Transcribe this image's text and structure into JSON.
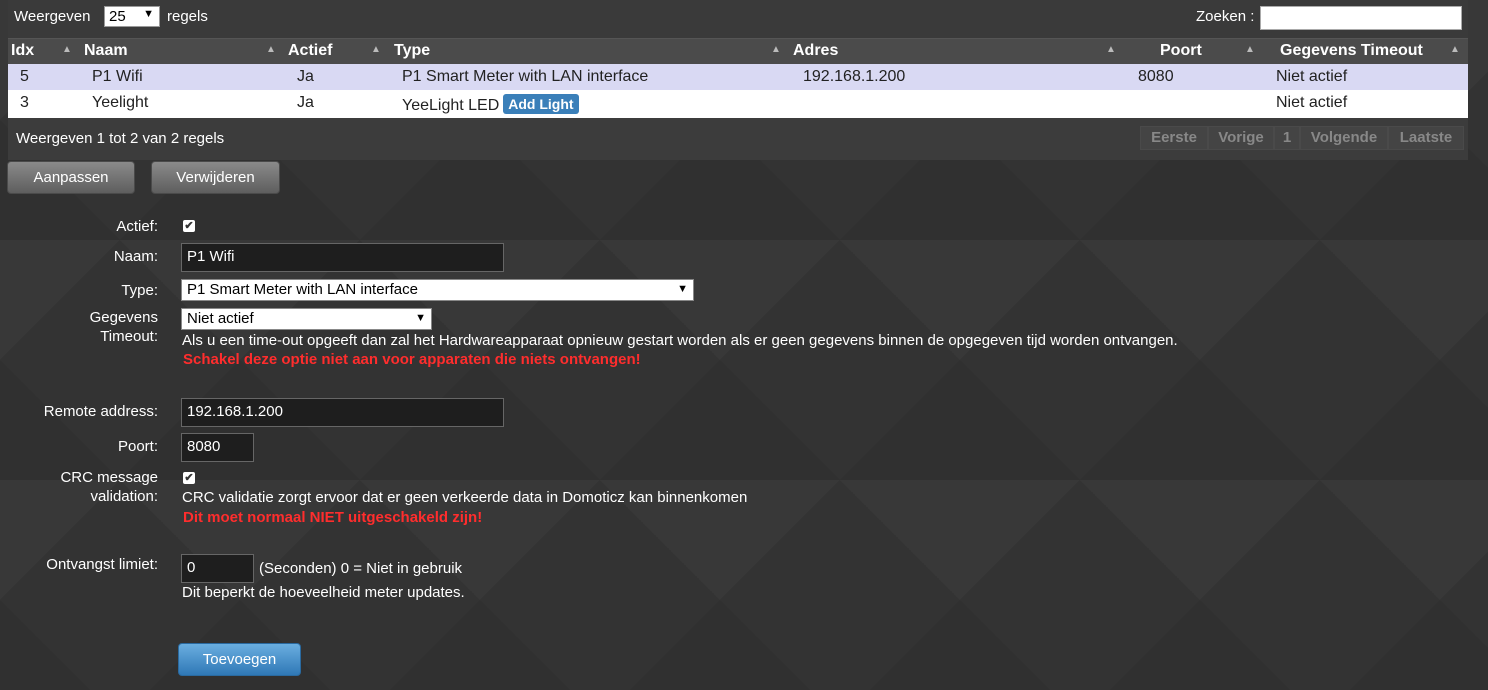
{
  "length_menu": {
    "prefix": "Weergeven",
    "value": "25",
    "suffix": "regels"
  },
  "search": {
    "label": "Zoeken :",
    "value": ""
  },
  "table": {
    "columns": [
      "Idx",
      "Naam",
      "Actief",
      "Type",
      "Adres",
      "Poort",
      "Gegevens Timeout"
    ],
    "rows": [
      {
        "idx": "5",
        "naam": "P1 Wifi",
        "actief": "Ja",
        "type": "P1 Smart Meter with LAN interface",
        "adres": "192.168.1.200",
        "poort": "8080",
        "timeout": "Niet actief"
      },
      {
        "idx": "3",
        "naam": "Yeelight",
        "actief": "Ja",
        "type": "YeeLight LED",
        "type_button": "Add Light",
        "adres": "",
        "poort": "",
        "timeout": "Niet actief"
      }
    ],
    "info": "Weergeven 1 tot 2 van 2 regels",
    "pager": {
      "first": "Eerste",
      "prev": "Vorige",
      "current": "1",
      "next": "Volgende",
      "last": "Laatste"
    }
  },
  "actions": {
    "edit": "Aanpassen",
    "delete": "Verwijderen"
  },
  "form": {
    "actief_label": "Actief:",
    "actief_checked": true,
    "naam_label": "Naam:",
    "naam_value": "P1 Wifi",
    "type_label": "Type:",
    "type_value": "P1 Smart Meter with LAN interface",
    "timeout_label_1": "Gegevens",
    "timeout_label_2": "Timeout:",
    "timeout_value": "Niet actief",
    "timeout_help": "Als u een time-out opgeeft dan zal het Hardwareapparaat opnieuw gestart worden als er geen gegevens binnen de opgegeven tijd worden ontvangen.",
    "timeout_warning": "Schakel deze optie niet aan voor apparaten die niets ontvangen!",
    "remote_label": "Remote address:",
    "remote_value": "192.168.1.200",
    "poort_label": "Poort:",
    "poort_value": "8080",
    "crc_label_1": "CRC message",
    "crc_label_2": "validation:",
    "crc_checked": true,
    "crc_help": "CRC validatie zorgt ervoor dat er geen verkeerde data in Domoticz kan binnenkomen",
    "crc_warning": "Dit moet normaal NIET uitgeschakeld zijn!",
    "limit_label": "Ontvangst limiet:",
    "limit_value": "0",
    "limit_unit": "(Seconden) 0 = Niet in gebruik",
    "limit_help": "Dit beperkt de hoeveelheid meter updates.",
    "submit": "Toevoegen"
  }
}
